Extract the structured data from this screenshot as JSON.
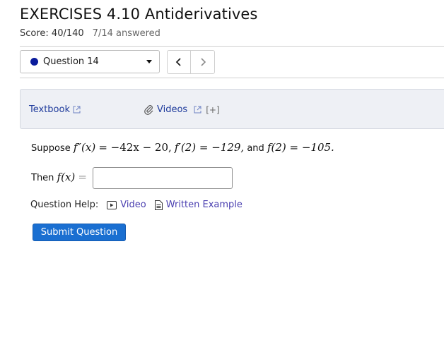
{
  "header": {
    "title": "EXERCISES 4.10 Antiderivatives",
    "score": "Score: 40/140",
    "answered": "7/14 answered"
  },
  "nav": {
    "question_select": "Question 14",
    "prev_icon": "chevron-left-icon",
    "next_icon": "chevron-right-icon"
  },
  "resources": {
    "textbook": "Textbook",
    "videos": "Videos",
    "expand": "[+]"
  },
  "problem": {
    "suppose": "Suppose",
    "f2prime_lhs": "f″(x)",
    "f2prime_rhs": "= −42x − 20,",
    "fprime": "f′(2) = −129,",
    "and": "and",
    "f_val": "f(2) = −105.",
    "then": "Then",
    "f_lhs": "f(x)",
    "equals": "=",
    "answer_value": ""
  },
  "help": {
    "label": "Question Help:",
    "video": "Video",
    "example": "Written Example"
  },
  "submit_label": "Submit Question",
  "colors": {
    "accent": "#1a6fd1",
    "link": "#1f3b9c",
    "status_dot": "#0a1b9c"
  }
}
